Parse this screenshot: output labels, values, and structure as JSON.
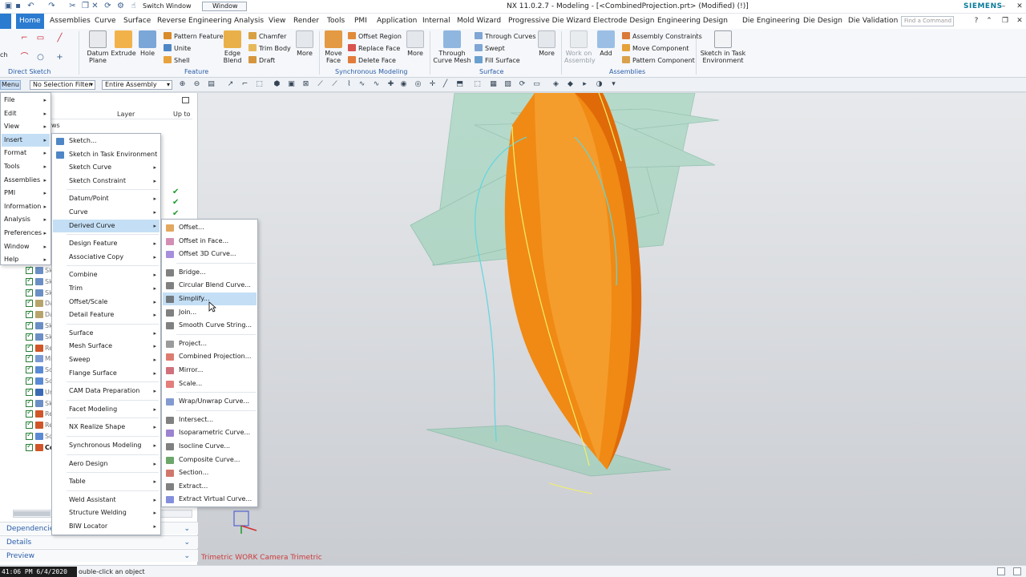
{
  "title_bar": {
    "switch_window": "Switch Window",
    "window_dropdown": "Window",
    "title": "NX 11.0.2.7 - Modeling - [<CombinedProjection.prt> (Modified)   (!)]",
    "brand": "SIEMENS"
  },
  "ribbon_tabs": [
    "Home",
    "Assemblies",
    "Curve",
    "Surface",
    "Reverse Engineering",
    "Analysis",
    "View",
    "Render",
    "Tools",
    "PMI",
    "Application",
    "Internal",
    "Mold Wizard",
    "Progressive Die Wizard",
    "Electrode Design",
    "Engineering Design",
    "Die Engineering",
    "Die Design",
    "Die Validation"
  ],
  "active_tab": "Home",
  "find_command_placeholder": "Find a Command",
  "ribbon": {
    "direct_sketch": {
      "label": "Direct Sketch",
      "sketch": "ch"
    },
    "feature": {
      "label": "Feature",
      "datum_plane": "Datum Plane",
      "extrude": "Extrude",
      "hole": "Hole",
      "pattern_feature": "Pattern Feature",
      "unite": "Unite",
      "shell": "Shell",
      "edge_blend": "Edge Blend",
      "chamfer": "Chamfer",
      "trim_body": "Trim Body",
      "draft": "Draft",
      "more": "More"
    },
    "synchronous": {
      "label": "Synchronous Modeling",
      "move_face": "Move Face",
      "offset_region": "Offset Region",
      "replace_face": "Replace Face",
      "delete_face": "Delete Face",
      "more": "More"
    },
    "surface": {
      "label": "Surface",
      "through_curve_mesh": "Through Curve Mesh",
      "through_curves": "Through Curves",
      "swept": "Swept",
      "fill_surface": "Fill Surface",
      "more": "More"
    },
    "assemblies": {
      "label": "Assemblies",
      "work_on_assembly": "Work on Assembly",
      "add": "Add",
      "assembly_constraints": "Assembly Constraints",
      "move_component": "Move Component",
      "pattern_component": "Pattern Component"
    },
    "sketch_task": "Sketch in Task Environment"
  },
  "selection_bar": {
    "menu": "Menu",
    "filter": "No Selection Filter",
    "scope": "Entire Assembly"
  },
  "navigator": {
    "columns": {
      "layer": "Layer",
      "up_to": "Up to"
    },
    "partial_label": "ws",
    "rows": [
      "Sk",
      "Sk",
      "Sk",
      "Da",
      "Da",
      "Sk",
      "Sk",
      "Re",
      "Mi",
      "Sc",
      "Sc",
      "Ur",
      "Sk",
      "Re",
      "Re",
      "Sc",
      "Co"
    ],
    "accordions": [
      "Dependencies",
      "Details",
      "Preview"
    ]
  },
  "main_menu": [
    {
      "label": "File",
      "submenu": true
    },
    {
      "label": "Edit",
      "submenu": true
    },
    {
      "label": "View",
      "submenu": true
    },
    {
      "label": "Insert",
      "submenu": true,
      "highlighted": true
    },
    {
      "label": "Format",
      "submenu": true
    },
    {
      "label": "Tools",
      "submenu": true
    },
    {
      "label": "Assemblies",
      "submenu": true
    },
    {
      "label": "PMI",
      "submenu": true
    },
    {
      "label": "Information",
      "submenu": true
    },
    {
      "label": "Analysis",
      "submenu": true
    },
    {
      "label": "Preferences",
      "submenu": true
    },
    {
      "label": "Window",
      "submenu": true
    },
    {
      "label": "Help",
      "submenu": true
    }
  ],
  "insert_menu": [
    {
      "label": "Sketch...",
      "submenu": false,
      "icon": "sketch-icon"
    },
    {
      "label": "Sketch in Task Environment",
      "submenu": false,
      "icon": "sketch-task-icon"
    },
    {
      "label": "Sketch Curve",
      "submenu": true
    },
    {
      "label": "Sketch Constraint",
      "submenu": true
    },
    {
      "label": "Datum/Point",
      "submenu": true
    },
    {
      "label": "Curve",
      "submenu": true
    },
    {
      "label": "Derived Curve",
      "submenu": true,
      "highlighted": true
    },
    {
      "label": "Design Feature",
      "submenu": true
    },
    {
      "label": "Associative Copy",
      "submenu": true
    },
    {
      "label": "Combine",
      "submenu": true
    },
    {
      "label": "Trim",
      "submenu": true
    },
    {
      "label": "Offset/Scale",
      "submenu": true
    },
    {
      "label": "Detail Feature",
      "submenu": true
    },
    {
      "label": "Surface",
      "submenu": true
    },
    {
      "label": "Mesh Surface",
      "submenu": true
    },
    {
      "label": "Sweep",
      "submenu": true
    },
    {
      "label": "Flange Surface",
      "submenu": true
    },
    {
      "label": "CAM Data Preparation",
      "submenu": true
    },
    {
      "label": "Facet Modeling",
      "submenu": true
    },
    {
      "label": "NX Realize Shape",
      "submenu": true
    },
    {
      "label": "Synchronous Modeling",
      "submenu": true
    },
    {
      "label": "Aero Design",
      "submenu": true
    },
    {
      "label": "Table",
      "submenu": true
    },
    {
      "label": "Weld Assistant",
      "submenu": true
    },
    {
      "label": "Structure Welding",
      "submenu": true
    },
    {
      "label": "BIW Locator",
      "submenu": true
    }
  ],
  "derived_curve_menu": [
    {
      "label": "Offset...",
      "icon": "offset-icon"
    },
    {
      "label": "Offset in Face...",
      "icon": "offset-in-face-icon"
    },
    {
      "label": "Offset 3D Curve...",
      "icon": "offset-3d-curve-icon"
    },
    {
      "label": "Bridge...",
      "icon": "bridge-icon"
    },
    {
      "label": "Circular Blend Curve...",
      "icon": "circular-blend-icon"
    },
    {
      "label": "Simplify...",
      "icon": "simplify-icon",
      "highlighted": true
    },
    {
      "label": "Join...",
      "icon": "join-icon"
    },
    {
      "label": "Smooth Curve String...",
      "icon": "smooth-curve-icon"
    },
    {
      "label": "Project...",
      "icon": "project-icon"
    },
    {
      "label": "Combined Projection...",
      "icon": "combined-projection-icon"
    },
    {
      "label": "Mirror...",
      "icon": "mirror-icon"
    },
    {
      "label": "Scale...",
      "icon": "scale-icon"
    },
    {
      "label": "Wrap/Unwrap Curve...",
      "icon": "wrap-icon"
    },
    {
      "label": "Intersect...",
      "icon": "intersect-icon"
    },
    {
      "label": "Isoparametric Curve...",
      "icon": "isoparametric-icon"
    },
    {
      "label": "Isocline Curve...",
      "icon": "isocline-icon"
    },
    {
      "label": "Composite Curve...",
      "icon": "composite-icon"
    },
    {
      "label": "Section...",
      "icon": "section-icon"
    },
    {
      "label": "Extract...",
      "icon": "extract-icon"
    },
    {
      "label": "Extract Virtual Curve...",
      "icon": "extract-virtual-icon"
    }
  ],
  "viewport": {
    "camera_label": "Trimetric WORK Camera Trimetric",
    "colors": {
      "body": "#f08a14",
      "body_dark": "#e06a08",
      "planes": "#8fcfb0",
      "curve_cyan": "#5fd6e0",
      "curve_yellow": "#f3f06a"
    }
  },
  "status_bar": {
    "clock": "41:06 PM 6/4/2020",
    "message": "ouble-click an object"
  }
}
